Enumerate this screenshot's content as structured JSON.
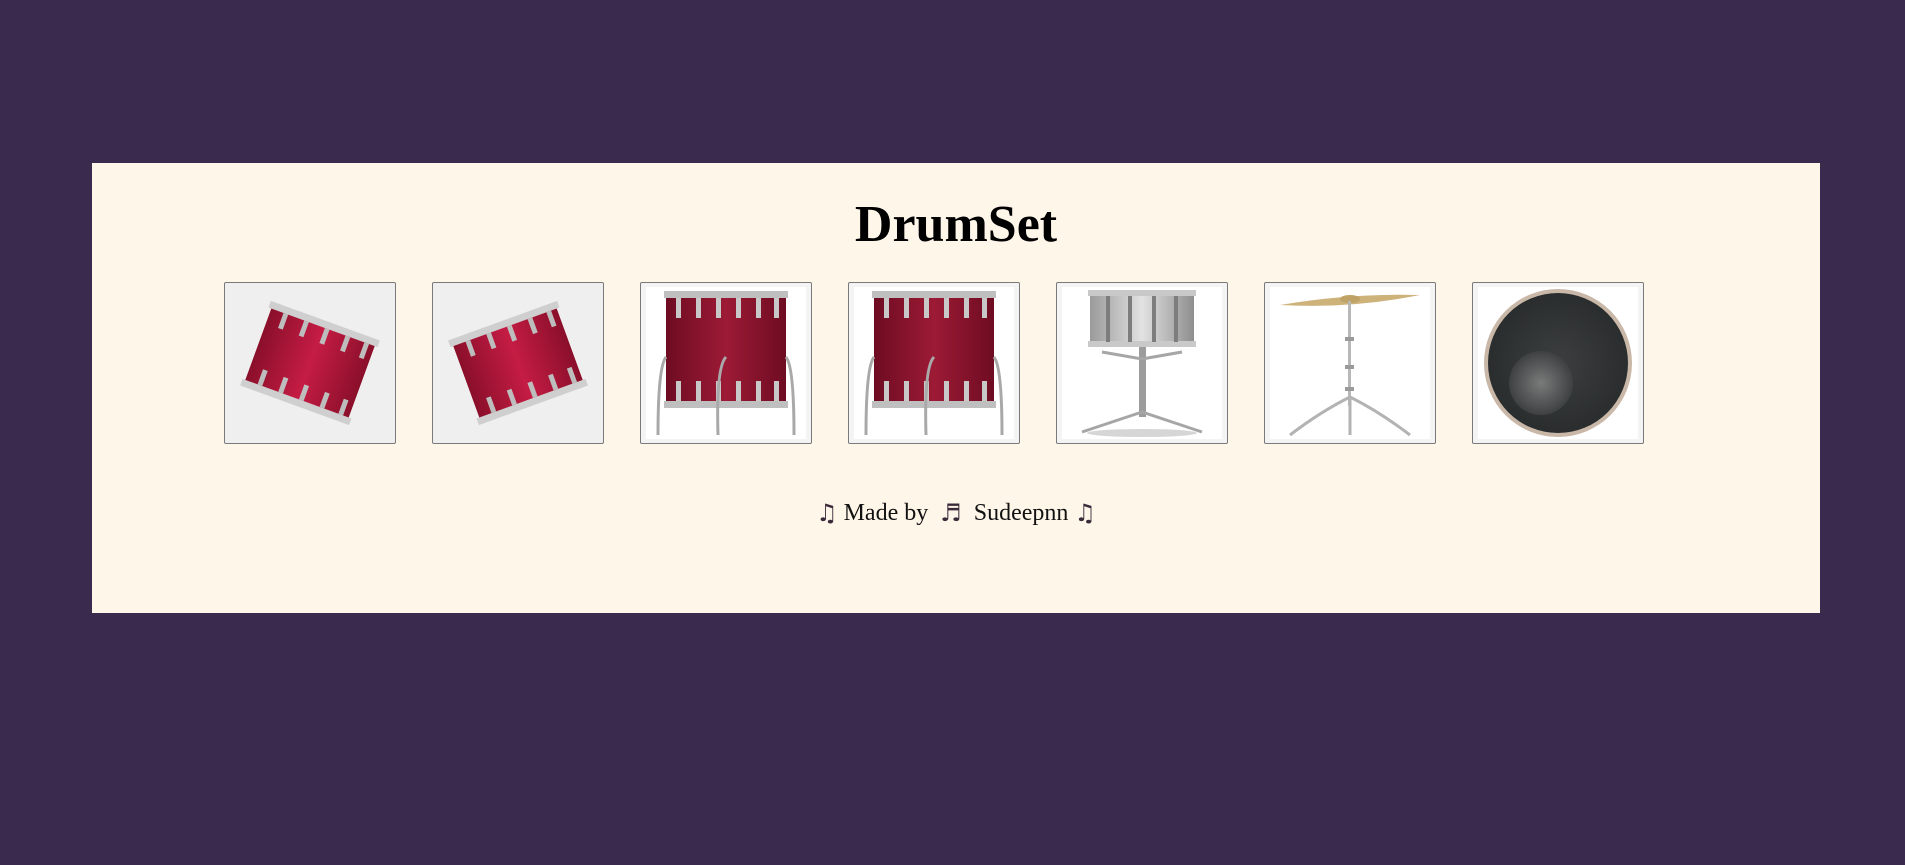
{
  "page": {
    "title": "DrumSet"
  },
  "drums": [
    {
      "icon": "tom-drum-tilted-left-icon"
    },
    {
      "icon": "tom-drum-tilted-right-icon"
    },
    {
      "icon": "floor-tom-icon"
    },
    {
      "icon": "floor-tom-icon"
    },
    {
      "icon": "snare-drum-icon"
    },
    {
      "icon": "cymbal-icon"
    },
    {
      "icon": "bass-drum-icon"
    }
  ],
  "footer": {
    "made_by": "Made by",
    "author": "Sudeepnn",
    "note_single": "♫",
    "note_double": "♬"
  },
  "colors": {
    "background": "#3a2a4d",
    "panel": "#fff6ea",
    "drum_red": "#b0183a"
  }
}
